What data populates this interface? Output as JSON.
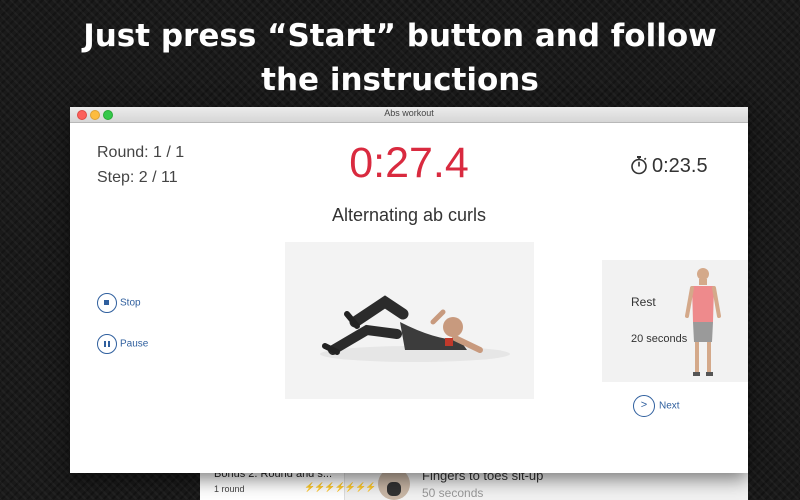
{
  "headline": {
    "line1": "Just press “Start” button and follow",
    "line2": "the instructions"
  },
  "background_app": {
    "list_item_title": "Bonus 2. Round and s...",
    "list_item_subtitle": "1 round",
    "exercise_title": "Fingers to toes sit-up",
    "exercise_subtitle": "50 seconds"
  },
  "window": {
    "title": "Abs workout",
    "round": "Round: 1 / 1",
    "step": "Step: 2 / 11",
    "timer": "0:27.4",
    "stopwatch": "0:23.5",
    "exercise_name": "Alternating ab curls",
    "controls": {
      "stop_label": "Stop",
      "pause_label": "Pause",
      "next_label": "Next"
    },
    "next_card": {
      "title": "Rest",
      "duration": "20 seconds"
    }
  },
  "colors": {
    "timer": "#d92a3f",
    "control": "#2f5f9e",
    "intensity": "#f08030"
  },
  "icons": [
    "stopwatch-icon",
    "stop-icon",
    "pause-icon",
    "chevron-right-icon"
  ]
}
